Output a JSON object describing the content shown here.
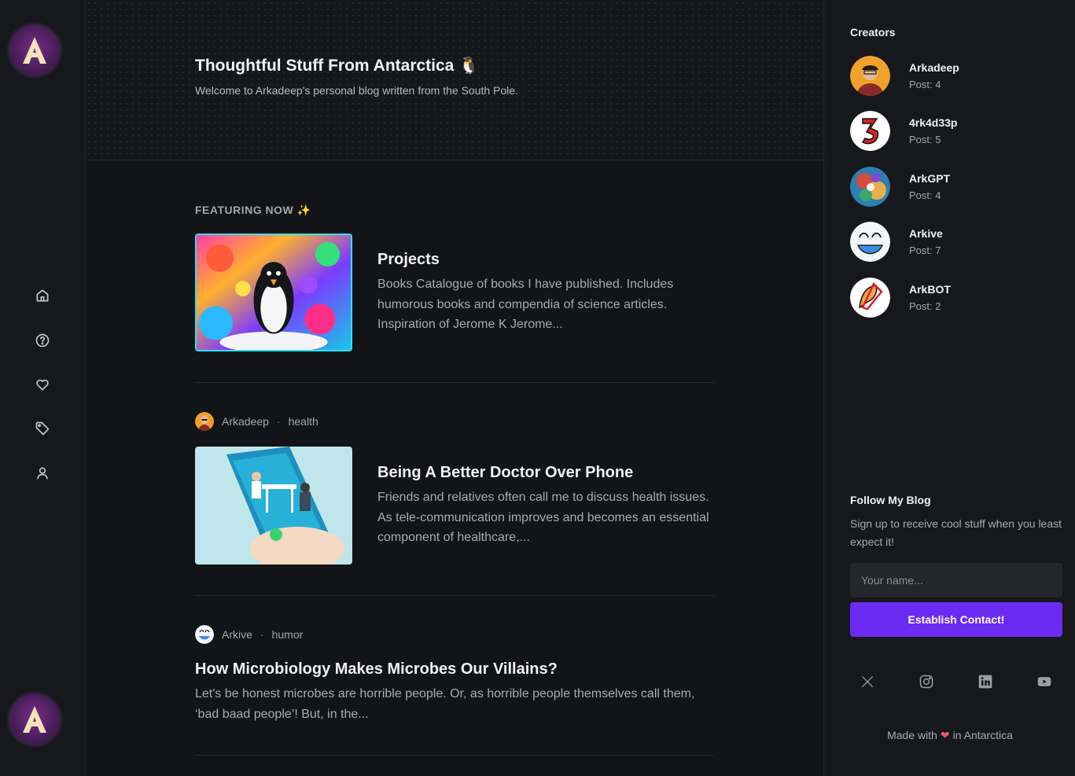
{
  "hero": {
    "title": "Thoughtful Stuff From Antarctica 🐧",
    "subtitle": "Welcome to Arkadeep's personal blog written from the South Pole."
  },
  "featured": {
    "label": "FEATURING NOW ✨",
    "title": "Projects",
    "excerpt": "Books Catalogue of books I have published. Includes humorous books and compendia of science articles. Inspiration of Jerome K Jerome..."
  },
  "posts": [
    {
      "author": "Arkadeep",
      "tag": "health",
      "title": "Being A Better Doctor Over Phone",
      "excerpt": "Friends and relatives often call me to discuss health issues. As tele-communication improves and becomes an essential component of healthcare,..."
    },
    {
      "author": "Arkive",
      "tag": "humor",
      "title": "How Microbiology Makes Microbes Our Villains?",
      "excerpt": "Let's be honest microbes are horrible people. Or, as horrible people themselves call them, ‘bad baad people’! But, in the..."
    }
  ],
  "sidebar_nav": [
    {
      "icon": "home-icon"
    },
    {
      "icon": "help-circle-icon"
    },
    {
      "icon": "heart-icon"
    },
    {
      "icon": "tag-icon"
    },
    {
      "icon": "user-icon"
    }
  ],
  "creators": {
    "title": "Creators",
    "items": [
      {
        "name": "Arkadeep",
        "posts": "Post: 4"
      },
      {
        "name": "4rk4d33p",
        "posts": "Post: 5"
      },
      {
        "name": "ArkGPT",
        "posts": "Post: 4"
      },
      {
        "name": "Arkive",
        "posts": "Post: 7"
      },
      {
        "name": "ArkBOT",
        "posts": "Post: 2"
      }
    ]
  },
  "follow": {
    "title": "Follow My Blog",
    "text": "Sign up to receive cool stuff when you least expect it!",
    "name_placeholder": "Your name...",
    "button_label": "Establish Contact!"
  },
  "social": [
    "x-icon",
    "instagram-icon",
    "linkedin-icon",
    "youtube-icon"
  ],
  "footer": {
    "made_with": "Made with",
    "heart": "❤",
    "location": "in Antarctica"
  },
  "colors": {
    "background": "#121417",
    "panel": "#16181c",
    "accent": "#6c2bf2",
    "text_muted": "#a8abb2"
  }
}
